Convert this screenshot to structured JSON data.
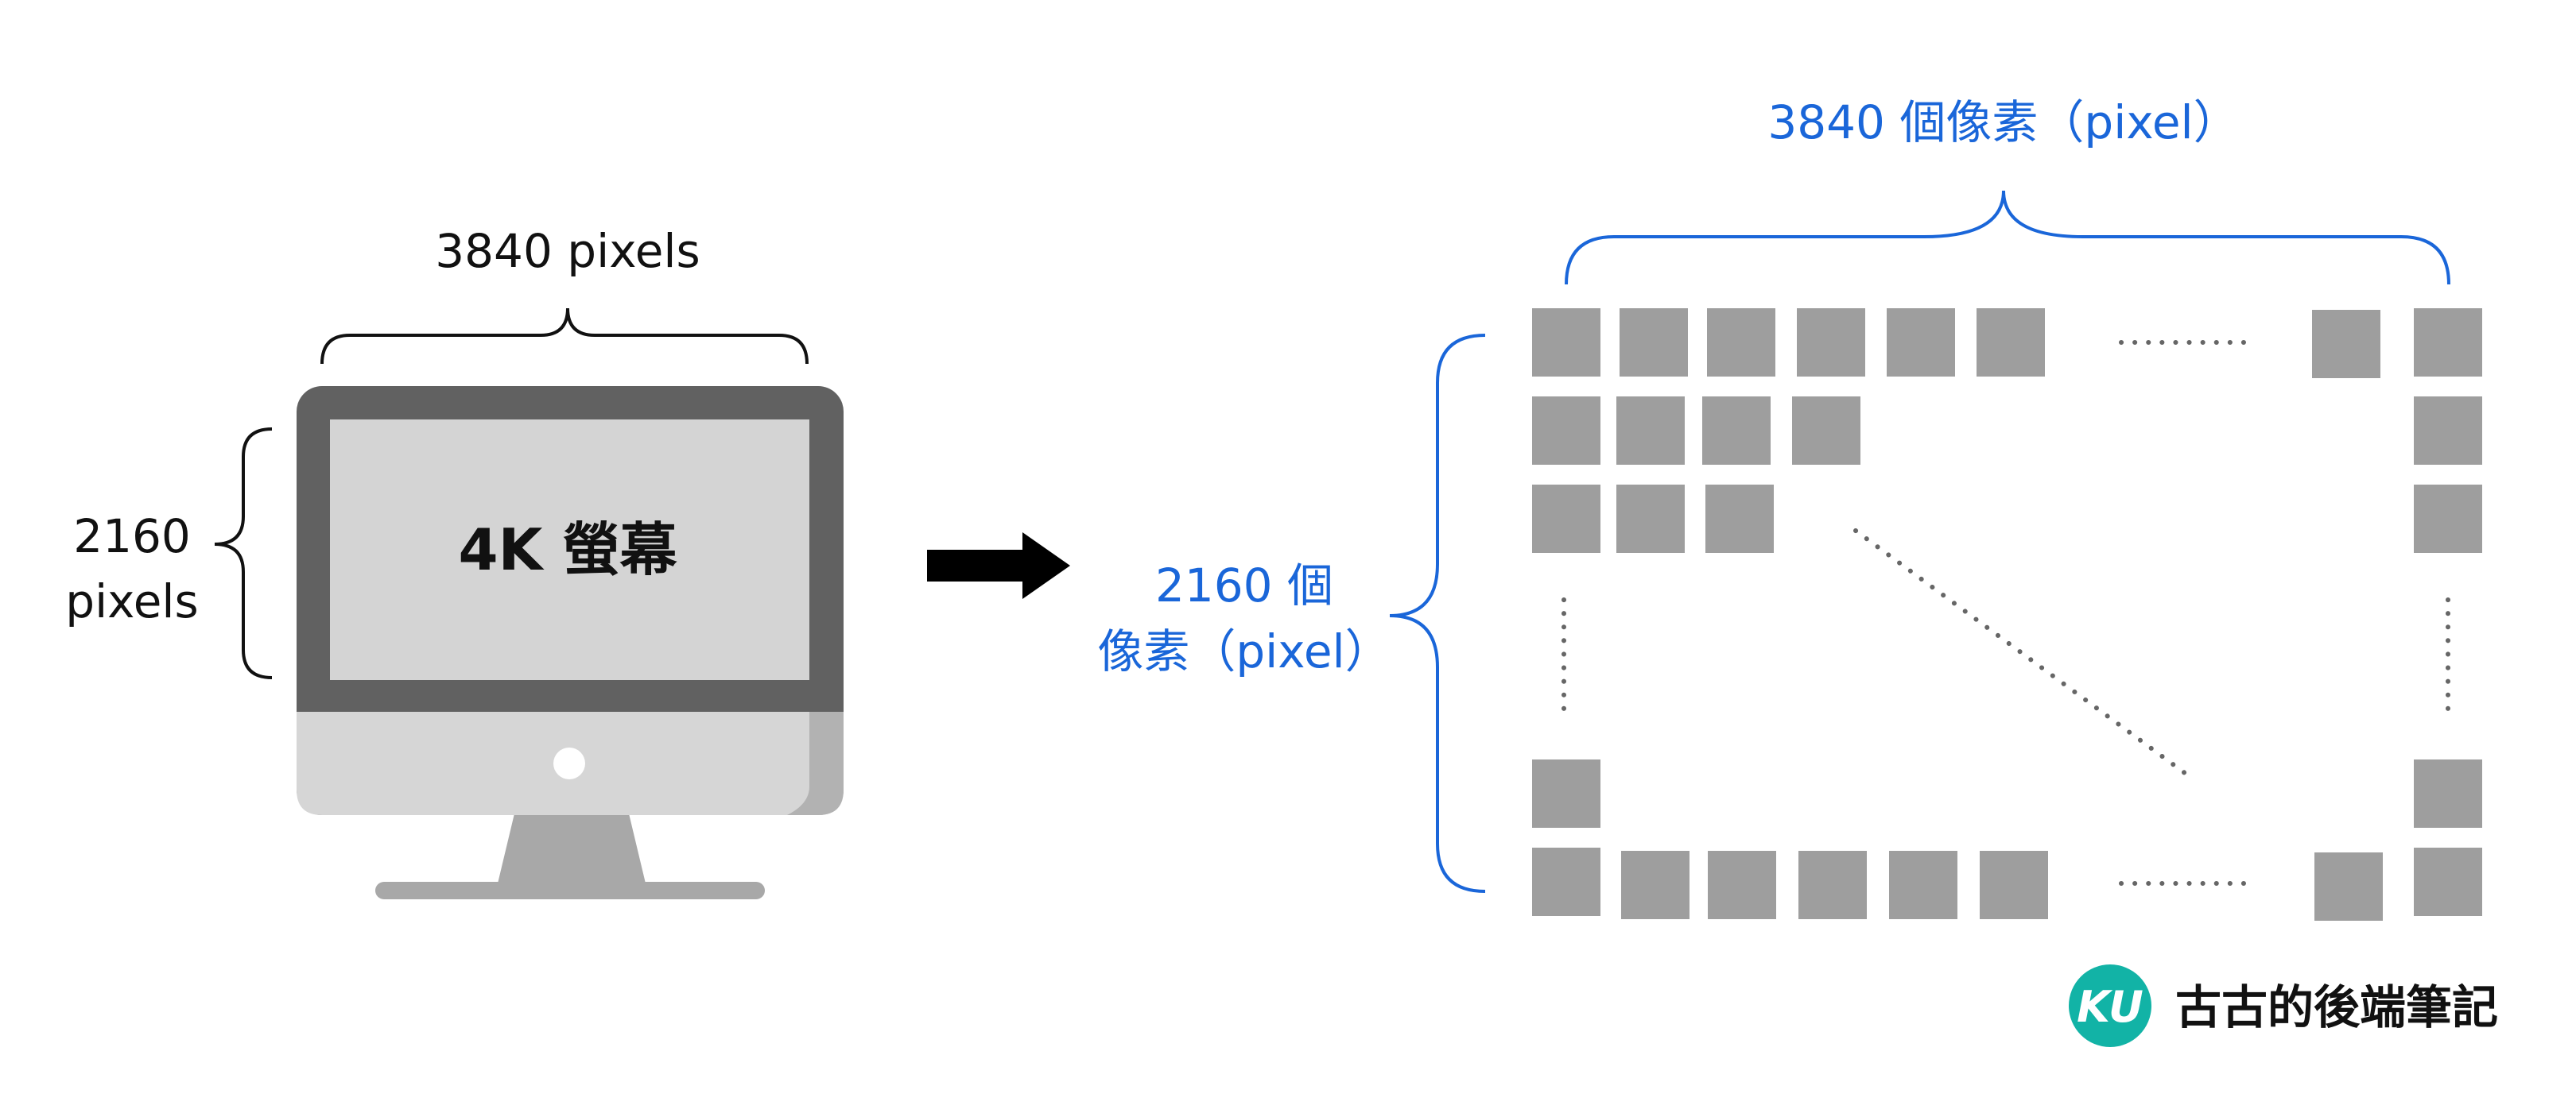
{
  "monitor": {
    "width_label": "3840 pixels",
    "height_label_line1": "2160",
    "height_label_line2": "pixels",
    "screen_label": "4K 螢幕"
  },
  "pixel_grid": {
    "width_label": "3840 個像素（pixel）",
    "height_label_line1": "2160 個",
    "height_label_line2": "像素（pixel）"
  },
  "brand": {
    "logo_text": "KU",
    "name": "古古的後端筆記",
    "logo_color": "#12b3a6"
  },
  "colors": {
    "accent_blue": "#1a66d9",
    "pixel_gray": "#9e9e9e",
    "monitor_frame": "#616161",
    "monitor_screen": "#d4d4d4",
    "monitor_chin": "#d6d6d6",
    "stand": "#a8a8a8"
  }
}
